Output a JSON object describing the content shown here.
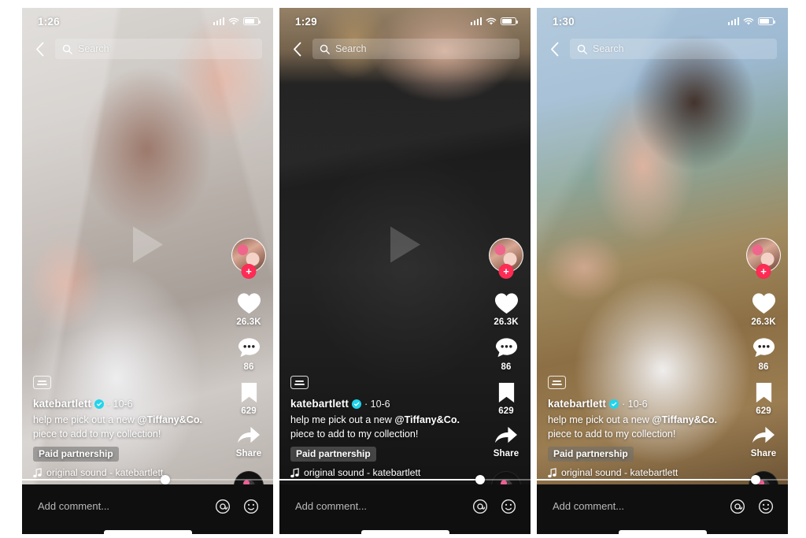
{
  "app": "TikTok",
  "background_color": "#ffffff",
  "accent_color": "#fe2c55",
  "verified_color": "#20d5ec",
  "shared": {
    "search_placeholder": "Search",
    "comment_placeholder": "Add comment...",
    "author": "katebartlett",
    "post_date": "· 10-6",
    "caption_before": "help me pick out a new ",
    "caption_mention": "@Tiffany&Co.",
    "caption_after": " piece to add to my collection!",
    "paid_partnership": "Paid partnership",
    "sound_label": "original sound - katebartlett",
    "like_count": "26.3K",
    "comment_count": "86",
    "bookmark_count": "629",
    "share_label": "Share",
    "follow_plus": "+",
    "icons": {
      "back": "back-chevron-icon",
      "search": "search-icon",
      "play": "play-icon",
      "heart": "heart-icon",
      "comment": "comment-bubble-icon",
      "bookmark": "bookmark-icon",
      "share": "share-arrow-icon",
      "music_note": "music-note-icon",
      "closed_caption": "closed-caption-icon",
      "mention": "mention-at-icon",
      "emoji": "emoji-smiley-icon",
      "signal": "cellular-signal-icon",
      "wifi": "wifi-icon",
      "battery": "battery-icon"
    }
  },
  "phones": [
    {
      "id": "phone-1",
      "time": "1:26",
      "scene": "creator holding a silver chain bracelet up to camera in a bright bathroom",
      "progress_percent": 57,
      "show_play_overlay": true
    },
    {
      "id": "phone-2",
      "time": "1:29",
      "scene": "hands lifting pearl and silver necklaces out of a dark jewelry case",
      "progress_percent": 80,
      "show_play_overlay": true
    },
    {
      "id": "phone-3",
      "time": "1:30",
      "scene": "creator wearing the layered pearl and heart-tag necklaces in a white tee",
      "progress_percent": 87,
      "show_play_overlay": false
    }
  ]
}
